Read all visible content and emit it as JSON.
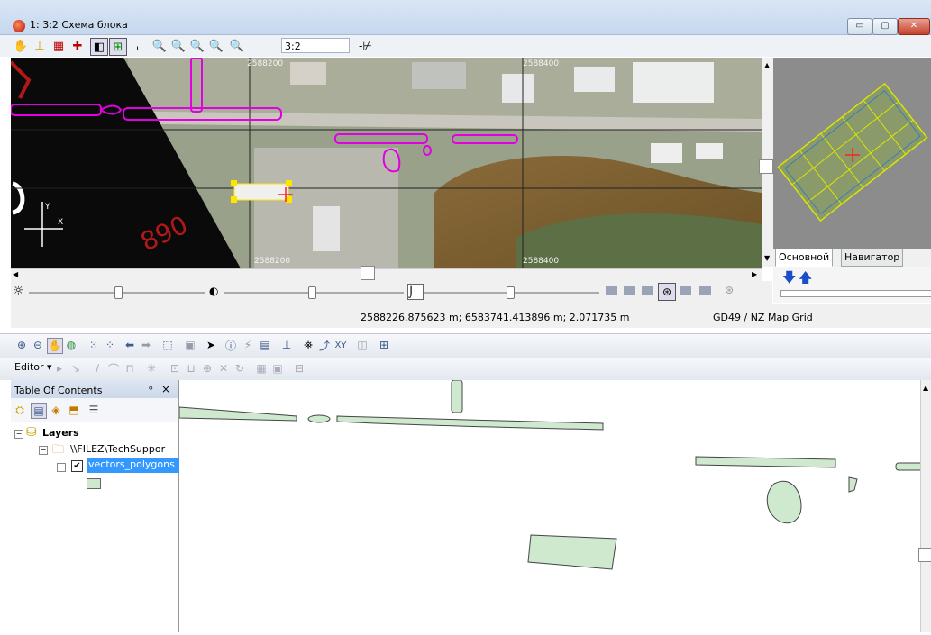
{
  "window": {
    "title": "1: 3:2 Схема блока",
    "min_label": "▭",
    "max_label": "▢",
    "close_label": "✕"
  },
  "toolbar": {
    "scale_value": "3:2",
    "tools": [
      "pan-icon",
      "add-point-icon",
      "select-frame-icon",
      "add-layer-icon",
      "view-mode-icon",
      "grid-icon",
      "corner-icon",
      "zoom-in-icon",
      "zoom-out-icon",
      "zoom-rect-icon",
      "zoom-extent-icon",
      "zoom-full-icon"
    ]
  },
  "map": {
    "grid_labels": {
      "top_left": "2588200",
      "top_right": "2588400",
      "bottom_left": "2588200",
      "bottom_right": "2588400"
    },
    "axis_y": "Y",
    "axis_x": "X",
    "red_text": "890",
    "colors": {
      "vector": "#e000e0",
      "selection": "#ffe600",
      "cursor": "#ff0000"
    }
  },
  "navigator": {
    "tabs": [
      "Основной",
      "Навигатор"
    ],
    "active_tab": 0
  },
  "status": {
    "coords": "2588226.875623 m; 6583741.413896 m; 2.071735 m",
    "crs": "GD49 / NZ Map Grid"
  },
  "arcmap": {
    "editor_label": "Editor ▾",
    "toc_title": "Table Of Contents",
    "toc_pin": "ᵠ",
    "toc_close": "×",
    "layers_label": "Layers",
    "folder_label": "\\\\FILEZ\\TechSuppor",
    "layer_label": "vectors_polygons",
    "layer_checked": true,
    "colors": {
      "polygon_fill": "#cfe9cf",
      "selection": "#3399ff"
    }
  }
}
